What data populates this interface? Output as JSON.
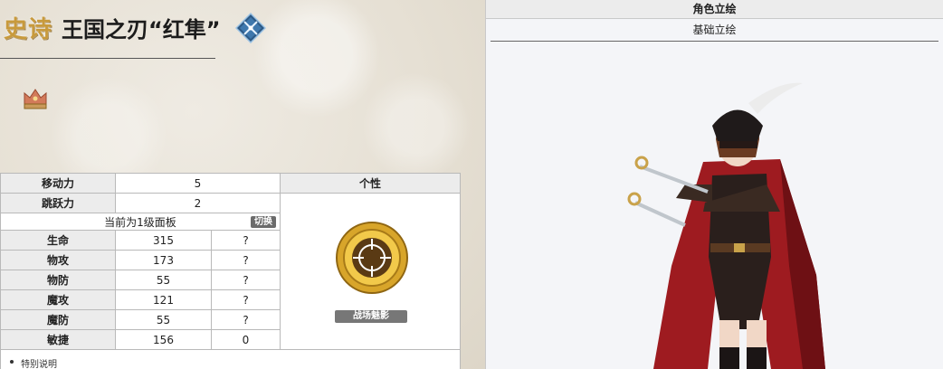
{
  "header": {
    "rarity": "史诗",
    "unit_name": "王国之刃“红隼”"
  },
  "stats": {
    "move_label": "移动力",
    "move_value": "5",
    "jump_label": "跳跃力",
    "jump_value": "2",
    "trait_header": "个性",
    "panel_text": "当前为1级面板",
    "switch_label": "切换",
    "rows": [
      {
        "label": "生命",
        "value": "315",
        "extra": "?"
      },
      {
        "label": "物攻",
        "value": "173",
        "extra": "?"
      },
      {
        "label": "物防",
        "value": "55",
        "extra": "?"
      },
      {
        "label": "魔攻",
        "value": "121",
        "extra": "?"
      },
      {
        "label": "魔防",
        "value": "55",
        "extra": "?"
      },
      {
        "label": "敏捷",
        "value": "156",
        "extra": "0"
      }
    ],
    "trait_name": "战场魅影"
  },
  "notes": {
    "item1": "特别说明"
  },
  "portrait_panel": {
    "title": "角色立绘",
    "tab": "基础立绘"
  },
  "icons": {
    "class": "crossed-swords-class-icon",
    "crown": "crown-icon",
    "trait": "crosshair-trait-icon"
  },
  "colors": {
    "rarity_gold": "#c89a3c",
    "cloak_red": "#b51f24"
  }
}
